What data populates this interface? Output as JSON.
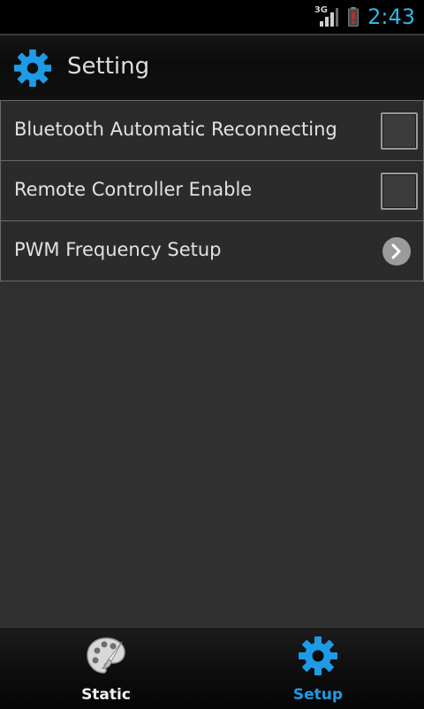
{
  "status_bar": {
    "network": "3G",
    "time": "2:43"
  },
  "header": {
    "title": "Setting",
    "icon": "gear-icon"
  },
  "settings": [
    {
      "label": "Bluetooth Automatic Reconnecting",
      "control": "checkbox",
      "checked": false
    },
    {
      "label": "Remote Controller Enable",
      "control": "checkbox",
      "checked": false
    },
    {
      "label": "PWM Frequency Setup",
      "control": "chevron"
    }
  ],
  "bottom_nav": {
    "tabs": [
      {
        "label": "Static",
        "icon": "palette-icon",
        "active": false
      },
      {
        "label": "Setup",
        "icon": "gear-icon",
        "active": true
      }
    ]
  },
  "colors": {
    "accent": "#1e9be6",
    "clock": "#33b5e5",
    "tab_inactive": "#f0f0f0"
  }
}
